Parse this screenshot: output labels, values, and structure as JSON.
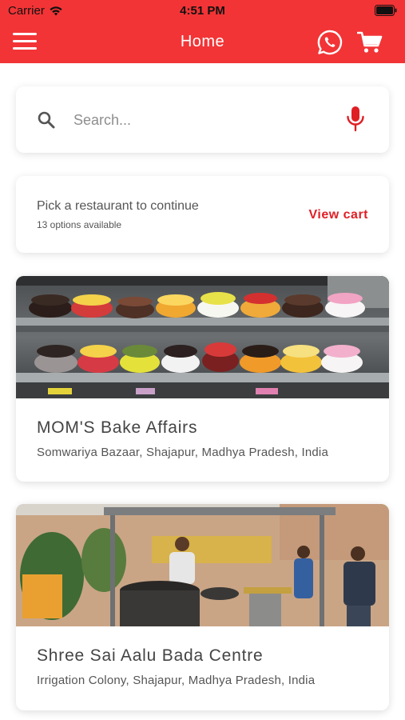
{
  "status_bar": {
    "carrier": "Carrier",
    "time": "4:51 PM"
  },
  "nav": {
    "title": "Home",
    "icons": [
      "menu-icon",
      "whatsapp-icon",
      "cart-icon"
    ]
  },
  "search": {
    "placeholder": "Search...",
    "value": ""
  },
  "pick_card": {
    "title": "Pick a restaurant to continue",
    "subtitle": "13 options available",
    "view_cart_label": "View cart"
  },
  "restaurants": [
    {
      "name": "MOM'S Bake Affairs",
      "address": "Somwariya Bazaar, Shajapur, Madhya Pradesh, India"
    },
    {
      "name": "Shree Sai Aalu Bada Centre",
      "address": "Irrigation Colony, Shajapur, Madhya Pradesh, India"
    }
  ],
  "colors": {
    "brand": "#f23436",
    "accent_text": "#e01e25"
  }
}
